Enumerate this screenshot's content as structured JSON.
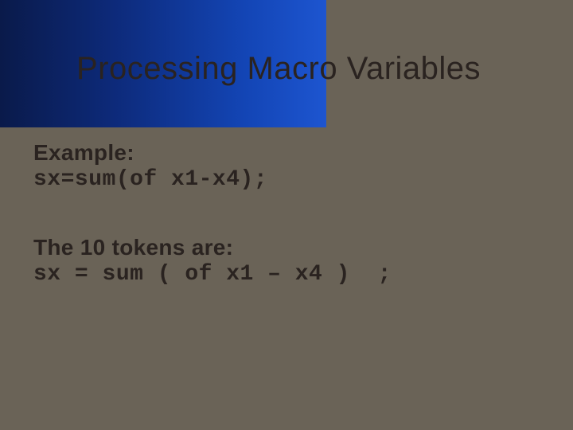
{
  "slide": {
    "title": "Processing Macro Variables",
    "example_label": "Example:",
    "example_code": "sx=sum(of x1-x4);",
    "tokens_label": "The 10 tokens are:",
    "tokens_code": "sx = sum ( of x1 – x4 )  ;"
  }
}
